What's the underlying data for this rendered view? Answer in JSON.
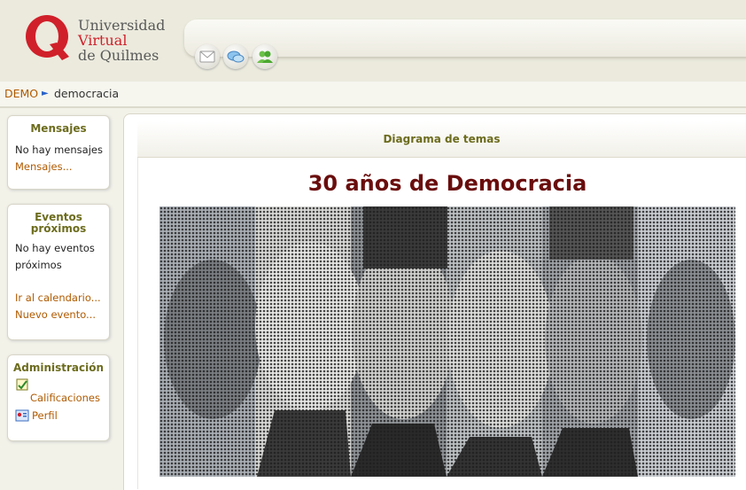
{
  "header": {
    "logo_lines": [
      "Universidad",
      "Virtual",
      "de Quilmes"
    ],
    "icons": [
      "mail-icon",
      "chat-icon",
      "users-icon"
    ]
  },
  "breadcrumb": {
    "home": "DEMO",
    "separator": "►",
    "current": "democracia"
  },
  "sidebar": {
    "mensajes": {
      "title": "Mensajes",
      "text": "No hay mensajes",
      "link": "Mensajes..."
    },
    "eventos": {
      "title_line1": "Eventos",
      "title_line2": "próximos",
      "text_line1": "No hay eventos",
      "text_line2": "próximos",
      "link_calendar": "Ir al calendario...",
      "link_new": "Nuevo evento..."
    },
    "administracion": {
      "title": "Administración",
      "items": [
        "Calificaciones",
        "Perfil"
      ]
    }
  },
  "main": {
    "topic_diagram": "Diagrama de temas",
    "section_title": "30 años de Democracia"
  },
  "colors": {
    "accent": "#b05a00",
    "title": "#6a0d0d",
    "block_title": "#6c6c1e",
    "brand_red": "#d0202a"
  }
}
